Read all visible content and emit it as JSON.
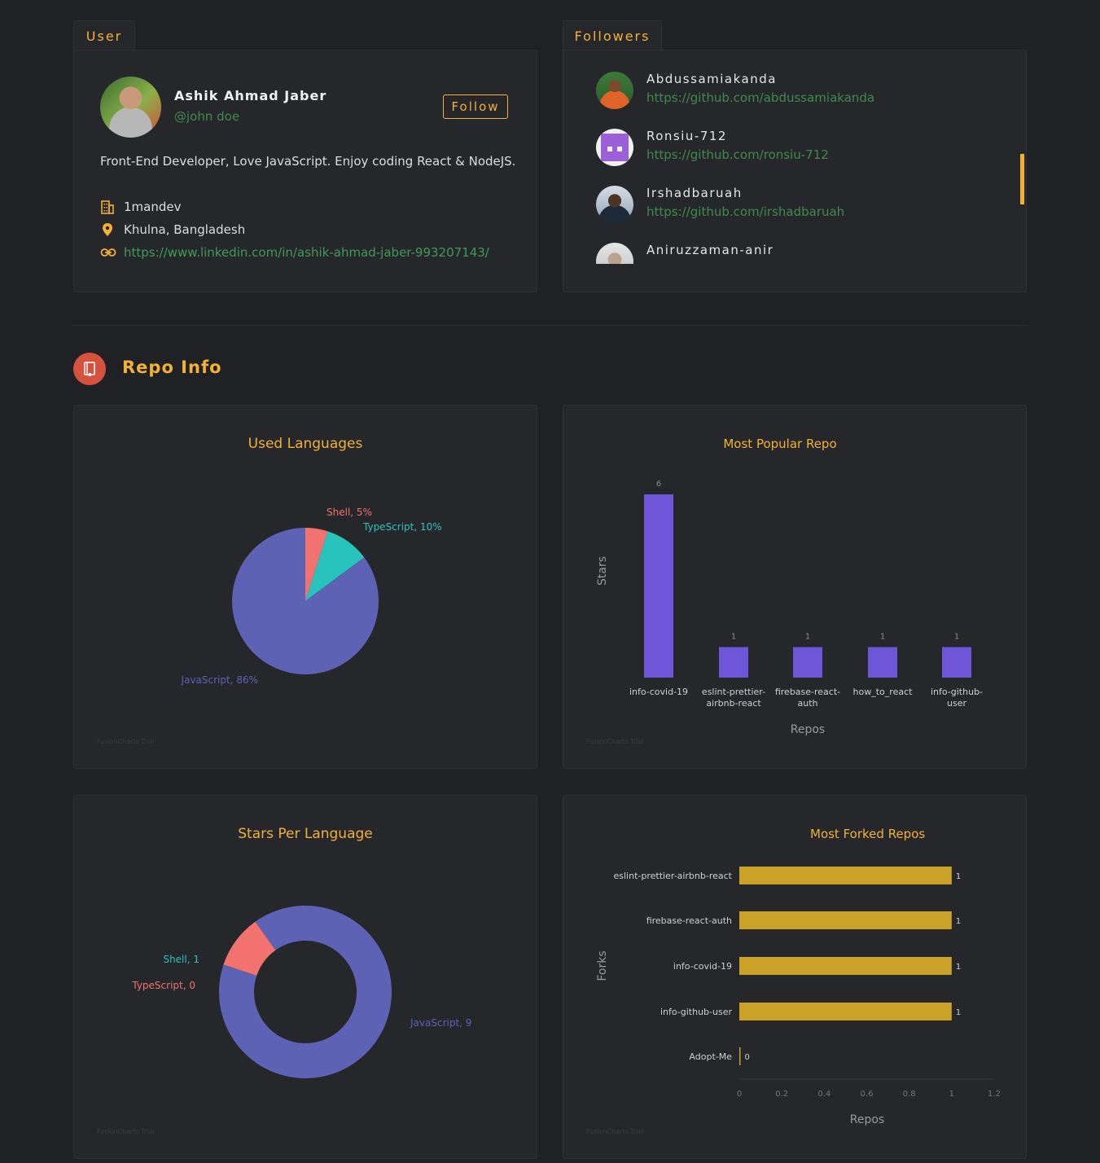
{
  "user_section": {
    "tab_label": "User",
    "name": "Ashik Ahmad Jaber",
    "handle": "@john doe",
    "follow_label": "Follow",
    "bio": "Front-End Developer, Love JavaScript. Enjoy coding React & NodeJS.",
    "company": "1mandev",
    "location": "Khulna, Bangladesh",
    "blog": "https://www.linkedin.com/in/ashik-ahmad-jaber-993207143/"
  },
  "followers_section": {
    "tab_label": "Followers",
    "items": [
      {
        "name": "Abdussamiakanda",
        "url": "https://github.com/abdussamiakanda"
      },
      {
        "name": "Ronsiu-712",
        "url": "https://github.com/ronsiu-712"
      },
      {
        "name": "Irshadbaruah",
        "url": "https://github.com/irshadbaruah"
      },
      {
        "name": "Aniruzzaman-anir",
        "url": ""
      }
    ]
  },
  "repo_section": {
    "title": "Repo Info",
    "trial_text": "FusionCharts Trial"
  },
  "colors": {
    "accent": "#f2b134",
    "javascript": "#5d62b5",
    "typescript": "#29c3be",
    "shell": "#f2726f",
    "bar_purple": "#6f56d8",
    "bar_gold": "#c9a227",
    "link_green": "#3f9b55"
  },
  "chart_data": [
    {
      "type": "pie",
      "title": "Used Languages",
      "categories": [
        "JavaScript",
        "TypeScript",
        "Shell"
      ],
      "values": [
        86,
        10,
        5
      ],
      "labels": [
        "JavaScript, 86%",
        "TypeScript, 10%",
        "Shell, 5%"
      ]
    },
    {
      "type": "bar",
      "title": "Most Popular Repo",
      "xlabel": "Repos",
      "ylabel": "Stars",
      "categories": [
        "info-covid-19",
        "eslint-prettier-airbnb-react",
        "firebase-react-auth",
        "how_to_react",
        "info-github-user"
      ],
      "category_lines": [
        [
          "info-covid-19"
        ],
        [
          "eslint-prettier-",
          "airbnb-react"
        ],
        [
          "firebase-react-",
          "auth"
        ],
        [
          "how_to_react"
        ],
        [
          "info-github-",
          "user"
        ]
      ],
      "values": [
        6,
        1,
        1,
        1,
        1
      ],
      "ylim": [
        0,
        6
      ]
    },
    {
      "type": "pie",
      "title": "Stars Per Language",
      "categories": [
        "JavaScript",
        "Shell",
        "TypeScript"
      ],
      "values": [
        9,
        1,
        0
      ],
      "labels": [
        "JavaScript, 9",
        "Shell, 1",
        "TypeScript, 0"
      ]
    },
    {
      "type": "bar",
      "orientation": "horizontal",
      "title": "Most Forked Repos",
      "xlabel": "Repos",
      "ylabel": "Forks",
      "categories": [
        "eslint-prettier-airbnb-react",
        "firebase-react-auth",
        "info-covid-19",
        "info-github-user",
        "Adopt-Me"
      ],
      "values": [
        1,
        1,
        1,
        1,
        0
      ],
      "xlim": [
        0,
        1.2
      ],
      "ticks": [
        "0",
        "0.2",
        "0.4",
        "0.6",
        "0.8",
        "1",
        "1.2"
      ]
    }
  ]
}
